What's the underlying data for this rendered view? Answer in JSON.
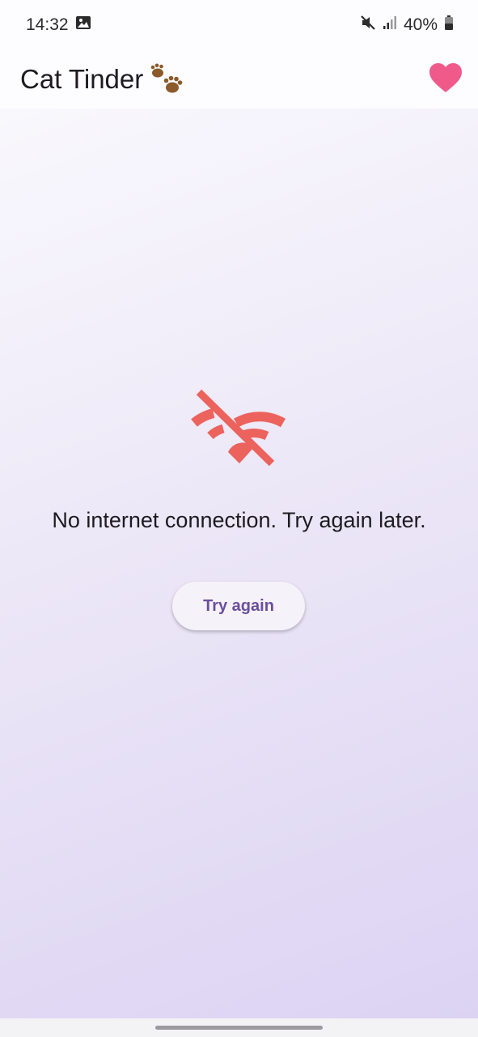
{
  "status_bar": {
    "time": "14:32",
    "battery": "40%",
    "icons": [
      "gallery-icon",
      "mute-icon",
      "signal-icon",
      "battery-icon"
    ]
  },
  "app_bar": {
    "title": "Cat Tinder",
    "title_icon": "paw-prints-icon",
    "action_icon": "heart-icon",
    "heart_color": "#ef5a8b"
  },
  "content": {
    "error_icon": "wifi-off-icon",
    "error_icon_color": "#ec625c",
    "message": "No internet connection. Try again later.",
    "retry_label": "Try again"
  },
  "colors": {
    "accent": "#6a4f9e",
    "background_gradient_end": "#dcd3f3"
  }
}
